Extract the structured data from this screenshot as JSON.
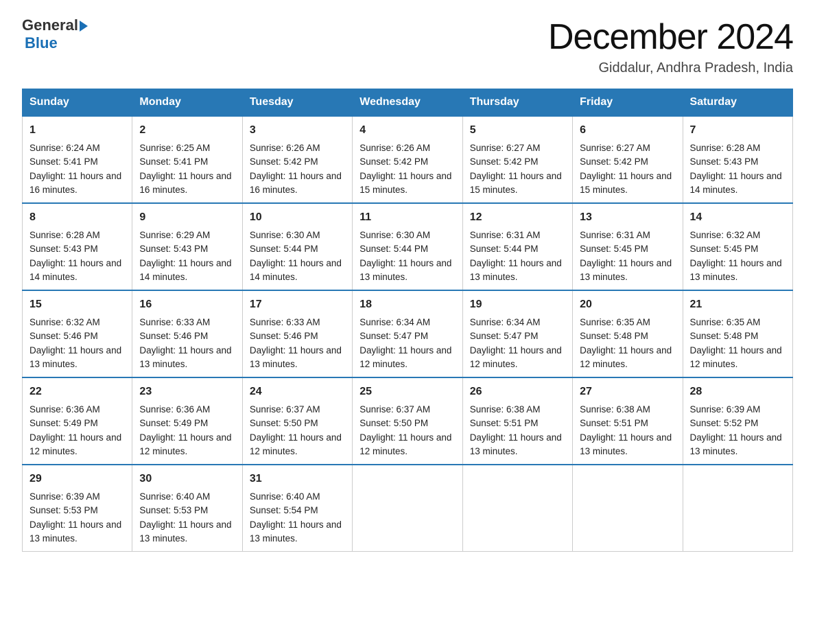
{
  "logo": {
    "general": "General",
    "blue": "Blue"
  },
  "title": "December 2024",
  "subtitle": "Giddalur, Andhra Pradesh, India",
  "days": [
    "Sunday",
    "Monday",
    "Tuesday",
    "Wednesday",
    "Thursday",
    "Friday",
    "Saturday"
  ],
  "weeks": [
    [
      {
        "num": "1",
        "sunrise": "6:24 AM",
        "sunset": "5:41 PM",
        "daylight": "11 hours and 16 minutes."
      },
      {
        "num": "2",
        "sunrise": "6:25 AM",
        "sunset": "5:41 PM",
        "daylight": "11 hours and 16 minutes."
      },
      {
        "num": "3",
        "sunrise": "6:26 AM",
        "sunset": "5:42 PM",
        "daylight": "11 hours and 16 minutes."
      },
      {
        "num": "4",
        "sunrise": "6:26 AM",
        "sunset": "5:42 PM",
        "daylight": "11 hours and 15 minutes."
      },
      {
        "num": "5",
        "sunrise": "6:27 AM",
        "sunset": "5:42 PM",
        "daylight": "11 hours and 15 minutes."
      },
      {
        "num": "6",
        "sunrise": "6:27 AM",
        "sunset": "5:42 PM",
        "daylight": "11 hours and 15 minutes."
      },
      {
        "num": "7",
        "sunrise": "6:28 AM",
        "sunset": "5:43 PM",
        "daylight": "11 hours and 14 minutes."
      }
    ],
    [
      {
        "num": "8",
        "sunrise": "6:28 AM",
        "sunset": "5:43 PM",
        "daylight": "11 hours and 14 minutes."
      },
      {
        "num": "9",
        "sunrise": "6:29 AM",
        "sunset": "5:43 PM",
        "daylight": "11 hours and 14 minutes."
      },
      {
        "num": "10",
        "sunrise": "6:30 AM",
        "sunset": "5:44 PM",
        "daylight": "11 hours and 14 minutes."
      },
      {
        "num": "11",
        "sunrise": "6:30 AM",
        "sunset": "5:44 PM",
        "daylight": "11 hours and 13 minutes."
      },
      {
        "num": "12",
        "sunrise": "6:31 AM",
        "sunset": "5:44 PM",
        "daylight": "11 hours and 13 minutes."
      },
      {
        "num": "13",
        "sunrise": "6:31 AM",
        "sunset": "5:45 PM",
        "daylight": "11 hours and 13 minutes."
      },
      {
        "num": "14",
        "sunrise": "6:32 AM",
        "sunset": "5:45 PM",
        "daylight": "11 hours and 13 minutes."
      }
    ],
    [
      {
        "num": "15",
        "sunrise": "6:32 AM",
        "sunset": "5:46 PM",
        "daylight": "11 hours and 13 minutes."
      },
      {
        "num": "16",
        "sunrise": "6:33 AM",
        "sunset": "5:46 PM",
        "daylight": "11 hours and 13 minutes."
      },
      {
        "num": "17",
        "sunrise": "6:33 AM",
        "sunset": "5:46 PM",
        "daylight": "11 hours and 13 minutes."
      },
      {
        "num": "18",
        "sunrise": "6:34 AM",
        "sunset": "5:47 PM",
        "daylight": "11 hours and 12 minutes."
      },
      {
        "num": "19",
        "sunrise": "6:34 AM",
        "sunset": "5:47 PM",
        "daylight": "11 hours and 12 minutes."
      },
      {
        "num": "20",
        "sunrise": "6:35 AM",
        "sunset": "5:48 PM",
        "daylight": "11 hours and 12 minutes."
      },
      {
        "num": "21",
        "sunrise": "6:35 AM",
        "sunset": "5:48 PM",
        "daylight": "11 hours and 12 minutes."
      }
    ],
    [
      {
        "num": "22",
        "sunrise": "6:36 AM",
        "sunset": "5:49 PM",
        "daylight": "11 hours and 12 minutes."
      },
      {
        "num": "23",
        "sunrise": "6:36 AM",
        "sunset": "5:49 PM",
        "daylight": "11 hours and 12 minutes."
      },
      {
        "num": "24",
        "sunrise": "6:37 AM",
        "sunset": "5:50 PM",
        "daylight": "11 hours and 12 minutes."
      },
      {
        "num": "25",
        "sunrise": "6:37 AM",
        "sunset": "5:50 PM",
        "daylight": "11 hours and 12 minutes."
      },
      {
        "num": "26",
        "sunrise": "6:38 AM",
        "sunset": "5:51 PM",
        "daylight": "11 hours and 13 minutes."
      },
      {
        "num": "27",
        "sunrise": "6:38 AM",
        "sunset": "5:51 PM",
        "daylight": "11 hours and 13 minutes."
      },
      {
        "num": "28",
        "sunrise": "6:39 AM",
        "sunset": "5:52 PM",
        "daylight": "11 hours and 13 minutes."
      }
    ],
    [
      {
        "num": "29",
        "sunrise": "6:39 AM",
        "sunset": "5:53 PM",
        "daylight": "11 hours and 13 minutes."
      },
      {
        "num": "30",
        "sunrise": "6:40 AM",
        "sunset": "5:53 PM",
        "daylight": "11 hours and 13 minutes."
      },
      {
        "num": "31",
        "sunrise": "6:40 AM",
        "sunset": "5:54 PM",
        "daylight": "11 hours and 13 minutes."
      },
      null,
      null,
      null,
      null
    ]
  ],
  "cell_labels": {
    "sunrise": "Sunrise:",
    "sunset": "Sunset:",
    "daylight": "Daylight:"
  }
}
